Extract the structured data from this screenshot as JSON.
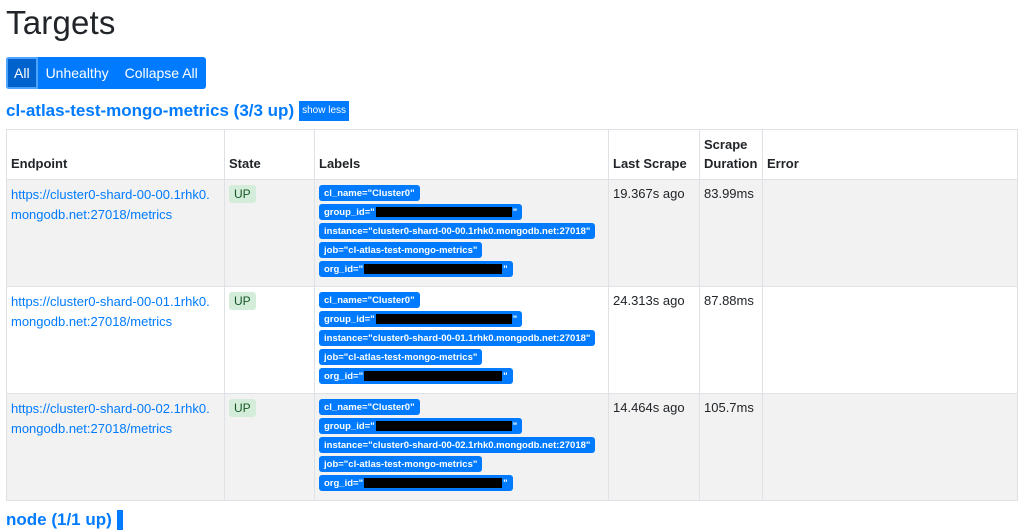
{
  "page": {
    "title": "Targets"
  },
  "filters": [
    {
      "label": "All",
      "active": true
    },
    {
      "label": "Unhealthy",
      "active": false
    },
    {
      "label": "Collapse All",
      "active": false
    }
  ],
  "job": {
    "name": "cl-atlas-test-mongo-metrics (3/3 up)",
    "toggle_label": "show less"
  },
  "table": {
    "headers": {
      "endpoint": "Endpoint",
      "state": "State",
      "labels": "Labels",
      "last_scrape": "Last Scrape",
      "scrape_duration_1": "Scrape",
      "scrape_duration_2": "Duration",
      "error": "Error"
    },
    "rows": [
      {
        "endpoint_1": "https://cluster0-shard-00-00.1rhk0.",
        "endpoint_2": "mongodb.net:27018/metrics",
        "state": "UP",
        "labels": {
          "cl_name": "cl_name=\"Cluster0\"",
          "group_id_prefix": "group_id=\"",
          "group_id_suffix": "\"",
          "instance": "instance=\"cluster0-shard-00-00.1rhk0.mongodb.net:27018\"",
          "job": "job=\"cl-atlas-test-mongo-metrics\"",
          "org_id_prefix": "org_id=\"",
          "org_id_suffix": "\""
        },
        "last_scrape": "19.367s ago",
        "scrape_duration": "83.99ms",
        "error": ""
      },
      {
        "endpoint_1": "https://cluster0-shard-00-01.1rhk0.",
        "endpoint_2": "mongodb.net:27018/metrics",
        "state": "UP",
        "labels": {
          "cl_name": "cl_name=\"Cluster0\"",
          "group_id_prefix": "group_id=\"",
          "group_id_suffix": "\"",
          "instance": "instance=\"cluster0-shard-00-01.1rhk0.mongodb.net:27018\"",
          "job": "job=\"cl-atlas-test-mongo-metrics\"",
          "org_id_prefix": "org_id=\"",
          "org_id_suffix": "\""
        },
        "last_scrape": "24.313s ago",
        "scrape_duration": "87.88ms",
        "error": ""
      },
      {
        "endpoint_1": "https://cluster0-shard-00-02.1rhk0.",
        "endpoint_2": "mongodb.net:27018/metrics",
        "state": "UP",
        "labels": {
          "cl_name": "cl_name=\"Cluster0\"",
          "group_id_prefix": "group_id=\"",
          "group_id_suffix": "\"",
          "instance": "instance=\"cluster0-shard-00-02.1rhk0.mongodb.net:27018\"",
          "job": "job=\"cl-atlas-test-mongo-metrics\"",
          "org_id_prefix": "org_id=\"",
          "org_id_suffix": "\""
        },
        "last_scrape": "14.464s ago",
        "scrape_duration": "105.7ms",
        "error": ""
      }
    ]
  },
  "next_job": {
    "name": "node (1/1 up)"
  },
  "colors": {
    "primary": "#007bff",
    "up_badge_bg": "#d4edda",
    "up_badge_text": "#155724"
  }
}
